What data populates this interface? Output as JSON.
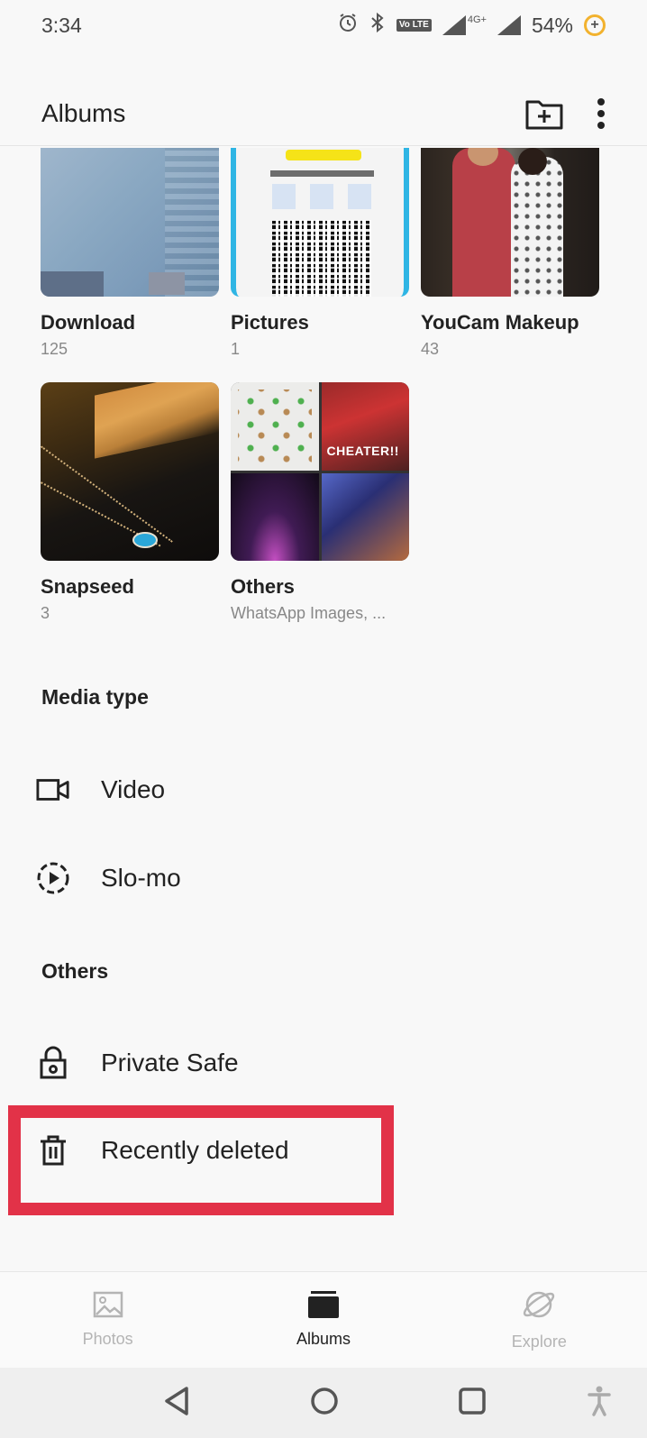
{
  "status_bar": {
    "time": "3:34",
    "network": "4G+",
    "battery": "54%",
    "icons": [
      "alarm-icon",
      "bluetooth-icon",
      "volte-icon",
      "signal-icon",
      "battery-saver-icon"
    ]
  },
  "app_bar": {
    "title": "Albums",
    "actions": [
      "new-folder-icon",
      "more-vert-icon"
    ]
  },
  "albums": [
    {
      "name": "Download",
      "count": "125"
    },
    {
      "name": "Pictures",
      "count": "1"
    },
    {
      "name": "YouCam Makeup",
      "count": "43"
    },
    {
      "name": "Snapseed",
      "count": "3"
    },
    {
      "name": "Others",
      "count": "WhatsApp Images, ..."
    }
  ],
  "media_type": {
    "title": "Media type",
    "items": [
      {
        "label": "Video",
        "icon": "video-icon"
      },
      {
        "label": "Slo-mo",
        "icon": "slo-mo-icon"
      }
    ]
  },
  "others": {
    "title": "Others",
    "items": [
      {
        "label": "Private Safe",
        "icon": "lock-icon"
      },
      {
        "label": "Recently deleted",
        "icon": "trash-icon"
      }
    ]
  },
  "pictures_thumb": {
    "banner": "CHEATER!!"
  },
  "bottom_nav": [
    {
      "label": "Photos",
      "icon": "image-icon",
      "active": false
    },
    {
      "label": "Albums",
      "icon": "albums-icon",
      "active": true
    },
    {
      "label": "Explore",
      "icon": "planet-icon",
      "active": false
    }
  ],
  "system_nav": [
    "back-icon",
    "home-icon",
    "recents-icon",
    "accessibility-icon"
  ],
  "colors": {
    "highlight": "#e23248",
    "background": "#f8f8f8",
    "text": "#222222",
    "muted": "#888888"
  }
}
